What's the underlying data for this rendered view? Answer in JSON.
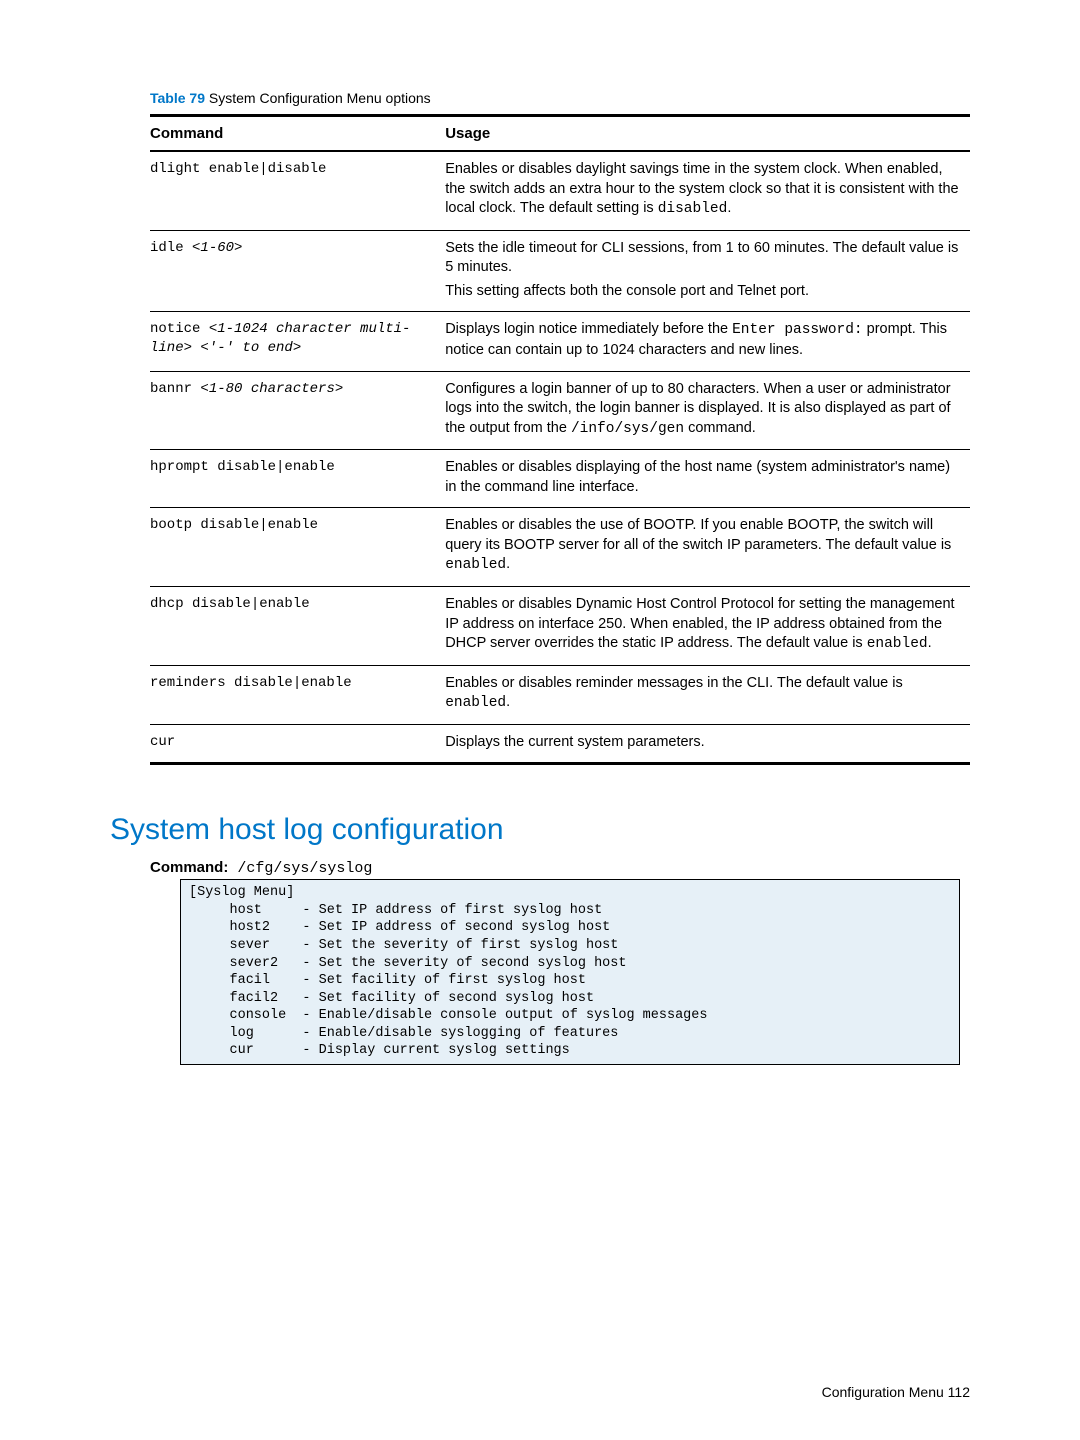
{
  "table_caption_label": "Table 79",
  "table_caption_text": "  System Configuration Menu options",
  "headers": {
    "c1": "Command",
    "c2": "Usage"
  },
  "rows": [
    {
      "cmd": "dlight enable|disable",
      "usage": [
        "Enables or disables daylight savings time in the system clock. When enabled, the switch adds an extra hour to the system clock so that it is consistent with the local clock. The default setting is <mono>disabled</mono>."
      ]
    },
    {
      "cmd": "idle <italic><1-60></italic>",
      "usage": [
        "Sets the idle timeout for CLI sessions, from 1 to 60 minutes. The default value is 5 minutes.",
        "This setting affects both the console port and Telnet port."
      ]
    },
    {
      "cmd": "notice <italic><1-1024 character multi-line> <'-' to end></italic>",
      "usage": [
        "Displays login notice immediately before the <mono>Enter password:</mono> prompt. This notice can contain up to 1024 characters and new lines."
      ]
    },
    {
      "cmd": "bannr <italic><1-80 characters></italic>",
      "usage": [
        "Configures a login banner of up to 80 characters. When a user or administrator logs into the switch, the login banner is displayed. It is also displayed as part of the output from the <mono>/info/sys/gen</mono> command."
      ]
    },
    {
      "cmd": "hprompt disable|enable",
      "usage": [
        "Enables or disables displaying of the host name (system administrator's name) in the command line interface."
      ]
    },
    {
      "cmd": "bootp disable|enable",
      "usage": [
        "Enables or disables the use of BOOTP. If you enable BOOTP, the switch will query its BOOTP server for all of the switch IP parameters. The default value is <mono>enabled</mono>."
      ]
    },
    {
      "cmd": "dhcp disable|enable",
      "usage": [
        "Enables or disables Dynamic Host Control Protocol for setting the management IP address on interface 250. When enabled, the IP address obtained from the DHCP server overrides the static IP address. The default value is <mono>enabled</mono>."
      ]
    },
    {
      "cmd": "reminders disable|enable",
      "usage": [
        "Enables or disables reminder messages in the CLI. The default value is <mono>enabled</mono>."
      ]
    },
    {
      "cmd": "cur",
      "usage": [
        "Displays the current system parameters."
      ]
    }
  ],
  "section_heading": "System host log configuration",
  "command_label": "Command:",
  "command_path": " /cfg/sys/syslog",
  "codebox": "[Syslog Menu]\n     host     - Set IP address of first syslog host\n     host2    - Set IP address of second syslog host\n     sever    - Set the severity of first syslog host\n     sever2   - Set the severity of second syslog host\n     facil    - Set facility of first syslog host\n     facil2   - Set facility of second syslog host\n     console  - Enable/disable console output of syslog messages\n     log      - Enable/disable syslogging of features\n     cur      - Display current syslog settings",
  "footer": "Configuration Menu   112"
}
